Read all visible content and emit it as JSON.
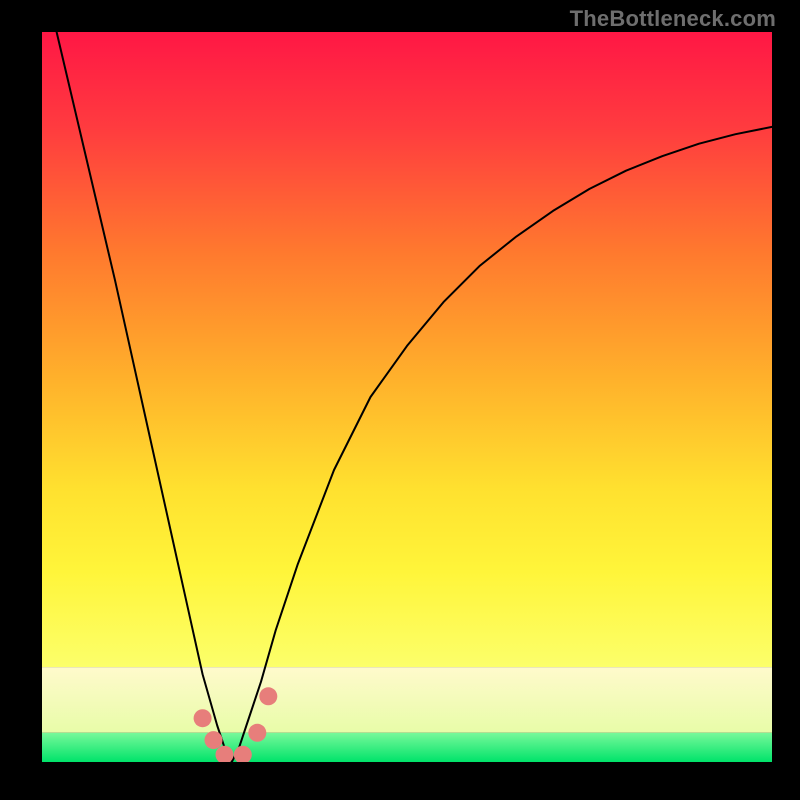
{
  "watermark": "TheBottleneck.com",
  "chart_data": {
    "type": "line",
    "title": "",
    "xlabel": "",
    "ylabel": "",
    "xlim": [
      0,
      100
    ],
    "ylim": [
      0,
      100
    ],
    "grid": false,
    "legend": false,
    "optimum_x": 26,
    "markers": [
      {
        "x": 22.0,
        "y": 6.0
      },
      {
        "x": 23.5,
        "y": 3.0
      },
      {
        "x": 25.0,
        "y": 1.0
      },
      {
        "x": 27.5,
        "y": 1.0
      },
      {
        "x": 29.5,
        "y": 4.0
      },
      {
        "x": 31.0,
        "y": 9.0
      }
    ],
    "curve": {
      "x": [
        2,
        6,
        10,
        14,
        18,
        20,
        22,
        24,
        25,
        26,
        27,
        28,
        30,
        32,
        35,
        40,
        45,
        50,
        55,
        60,
        65,
        70,
        75,
        80,
        85,
        90,
        95,
        100
      ],
      "y": [
        100,
        83,
        66,
        48,
        30,
        21,
        12,
        5,
        2,
        0,
        2,
        5,
        11,
        18,
        27,
        40,
        50,
        57,
        63,
        68,
        72,
        75.5,
        78.5,
        81,
        83,
        84.7,
        86,
        87
      ]
    },
    "green_band": {
      "y0": 0,
      "y1": 4,
      "color_top": "#78f89a",
      "color_bottom": "#00e36a"
    },
    "pale_band": {
      "y0": 4,
      "y1": 13,
      "color_top": "#fffacc",
      "color_bottom": "#e8fca8"
    },
    "gradient_stops": [
      {
        "offset": 0.0,
        "color": "#ff1745"
      },
      {
        "offset": 0.15,
        "color": "#ff3b3f"
      },
      {
        "offset": 0.35,
        "color": "#ff7a2e"
      },
      {
        "offset": 0.55,
        "color": "#ffb22b"
      },
      {
        "offset": 0.72,
        "color": "#ffe12f"
      },
      {
        "offset": 0.85,
        "color": "#fff53a"
      },
      {
        "offset": 1.0,
        "color": "#fcff6a"
      }
    ],
    "marker_style": {
      "fill": "#e77e7b",
      "r": 9
    }
  }
}
